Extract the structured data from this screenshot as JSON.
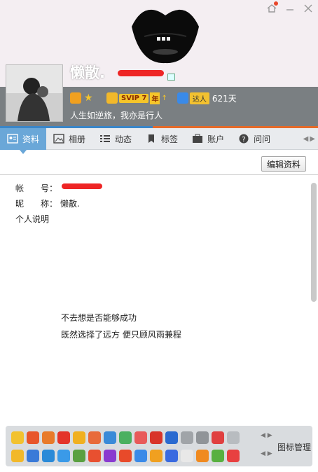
{
  "profile": {
    "nickname": "懒散.",
    "signature": "人生如逆旅，我亦是行人",
    "svip_label": "SVIP 7",
    "year_label": "年",
    "daren_label": "达人",
    "days": "621天"
  },
  "tabs": [
    {
      "label": "资料",
      "icon": "profile-card-icon",
      "active": true
    },
    {
      "label": "相册",
      "icon": "photo-album-icon"
    },
    {
      "label": "动态",
      "icon": "list-icon"
    },
    {
      "label": "标签",
      "icon": "bookmark-icon"
    },
    {
      "label": "账户",
      "icon": "wallet-icon"
    },
    {
      "label": "问问",
      "icon": "question-icon"
    }
  ],
  "edit_button": "编辑资料",
  "info": {
    "account_key": "帐　　号：",
    "nickname_key": "昵　　称：",
    "nickname_value": "懒散.",
    "desc_key": "个人说明"
  },
  "description": {
    "line1": "不去想是否能够成功",
    "line2": "既然选择了远方 便只顾风雨兼程"
  },
  "icon_panel": {
    "manage_label": "图标管理",
    "colors_row1": [
      "#f2c230",
      "#e8552a",
      "#e87a2a",
      "#e4342a",
      "#f0b020",
      "#e86a3a",
      "#3a8ad8",
      "#4ab060",
      "#e85a5a",
      "#d8342a",
      "#2a6ad0",
      "#a0a4a8",
      "#909498",
      "#e04040",
      "#b8bcc0"
    ],
    "colors_row2": [
      "#f2b82a",
      "#3a7ad8",
      "#2a8ad8",
      "#3a9ae8",
      "#5aa040",
      "#e85030",
      "#8a3ad0",
      "#e84a2a",
      "#3a8ae8",
      "#f0a020",
      "#3a6ae0",
      "#e8e8e8",
      "#f08a20",
      "#58b040",
      "#e84040"
    ]
  },
  "window": {
    "icons": [
      "home-icon",
      "minimize-icon",
      "close-icon"
    ]
  }
}
